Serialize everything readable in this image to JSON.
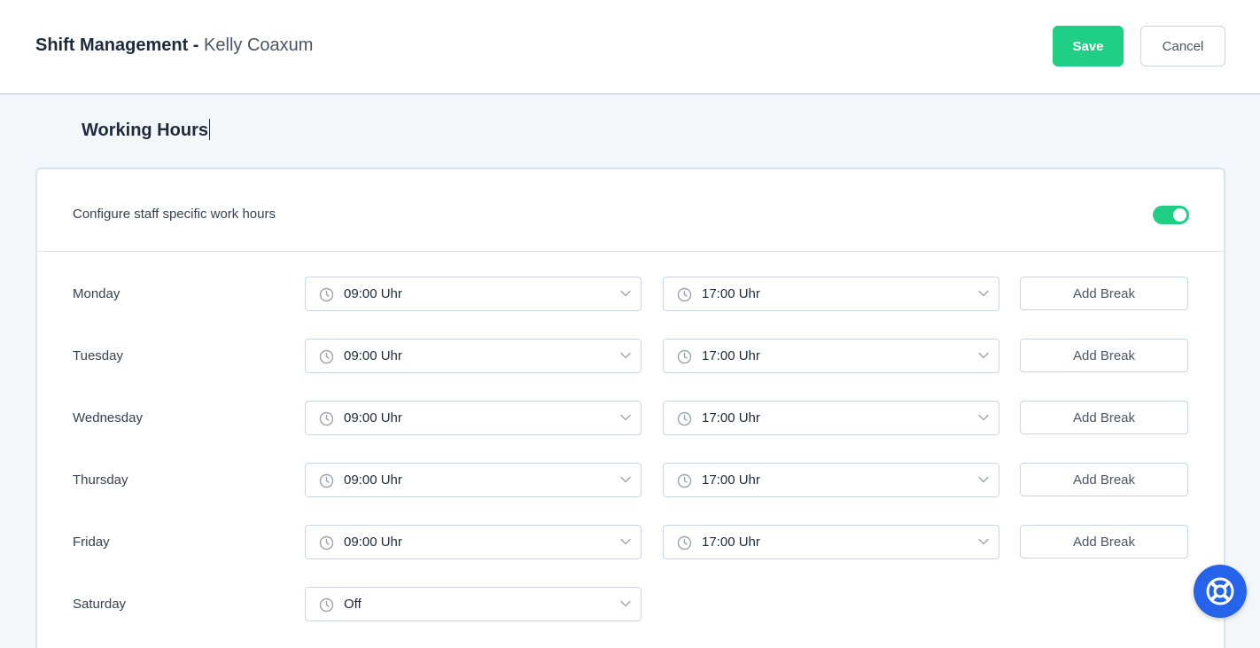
{
  "header": {
    "title": "Shift Management",
    "separator": " - ",
    "staff_name": "Kelly Coaxum",
    "save_label": "Save",
    "cancel_label": "Cancel"
  },
  "section": {
    "title": "Working Hours"
  },
  "settings": {
    "toggle_label": "Configure staff specific work hours",
    "toggle_on": true
  },
  "days": [
    {
      "name": "Monday",
      "start": "09:00 Uhr",
      "end": "17:00 Uhr",
      "break_label": "Add Break"
    },
    {
      "name": "Tuesday",
      "start": "09:00 Uhr",
      "end": "17:00 Uhr",
      "break_label": "Add Break"
    },
    {
      "name": "Wednesday",
      "start": "09:00 Uhr",
      "end": "17:00 Uhr",
      "break_label": "Add Break"
    },
    {
      "name": "Thursday",
      "start": "09:00 Uhr",
      "end": "17:00 Uhr",
      "break_label": "Add Break"
    },
    {
      "name": "Friday",
      "start": "09:00 Uhr",
      "end": "17:00 Uhr",
      "break_label": "Add Break"
    },
    {
      "name": "Saturday",
      "start": "Off"
    }
  ],
  "icons": {
    "time": "clock-icon",
    "dropdown": "chevron-down-icon",
    "help": "lifebuoy-icon"
  },
  "colors": {
    "accent": "#1ecf85",
    "help_button": "#2563eb"
  }
}
